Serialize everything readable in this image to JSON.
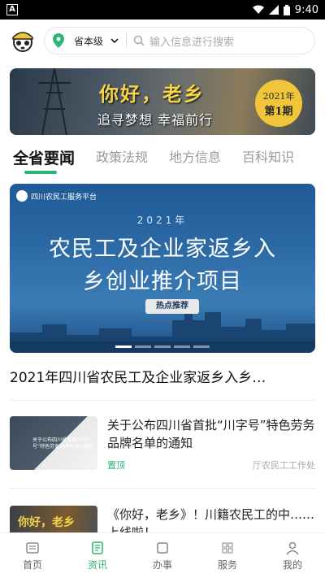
{
  "status_bar": {
    "time": "9:40",
    "left_badge": "A"
  },
  "header": {
    "region": "省本级",
    "search_placeholder": "输入信息进行搜索"
  },
  "banner": {
    "title": "你好，老乡",
    "subtitle": "追寻梦想 幸福前行",
    "badge_year": "2021年",
    "badge_issue": "第1期"
  },
  "tabs": [
    {
      "label": "全省要闻",
      "active": true
    },
    {
      "label": "政策法规",
      "active": false
    },
    {
      "label": "地方信息",
      "active": false
    },
    {
      "label": "百科知识",
      "active": false
    }
  ],
  "feature": {
    "brand": "四川农民工服务平台",
    "year": "2021年",
    "line1": "农民工及企业家返乡入",
    "line2": "乡创业推介项目",
    "tag": "热点推荐",
    "caption": "2021年四川省农民工及企业家返乡入乡…",
    "carousel_pages": 5,
    "carousel_active": 0
  },
  "news": [
    {
      "title": "关于公布四川省首批“川字号”特色劳务品牌名单的通知",
      "pin": "置顶",
      "source": "厅农民工工作处",
      "thumb_text": "关于公布四川省首批“川字号”特色劳务品牌名单的通知"
    },
    {
      "title": "《你好，老乡》！川籍农民工的中……上线啦！",
      "pin": "",
      "source": "",
      "thumb_text": "你好，老乡"
    }
  ],
  "bottom_nav": [
    {
      "label": "首页",
      "icon": "home-icon",
      "active": false
    },
    {
      "label": "资讯",
      "icon": "news-icon",
      "active": true
    },
    {
      "label": "办事",
      "icon": "service-icon",
      "active": false
    },
    {
      "label": "服务",
      "icon": "grid-icon",
      "active": false
    },
    {
      "label": "我的",
      "icon": "user-icon",
      "active": false
    }
  ],
  "colors": {
    "accent": "#2bb673",
    "banner_gold": "#f0c53a"
  }
}
